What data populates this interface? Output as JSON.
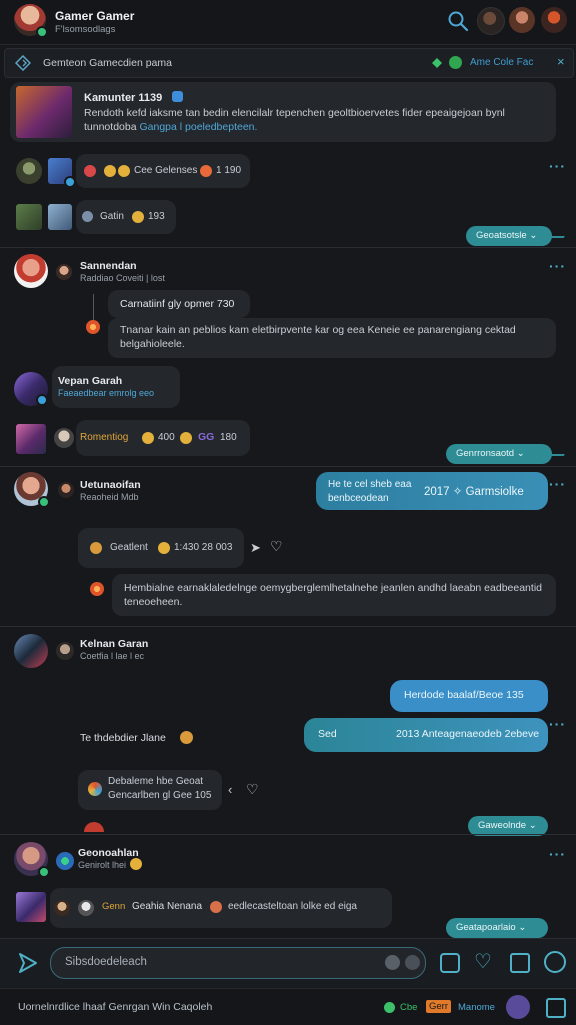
{
  "header": {
    "title": "Gamer Gamer",
    "subtitle": "F'lsomsodlags"
  },
  "banner": {
    "text": "Gemteon Gamecdien pama",
    "right_text": "Ame Cole Fac"
  },
  "messages": [
    {
      "title": "Kamunter 1139",
      "text": "Rendoth kefd iaksme tan bedin elencilalr tepenchen geoltbioervetes fider epeaigejoan bynl tunnotdoba",
      "link": "Gangpa l poeledbepteen."
    },
    {
      "reaction_label": "Cee Gelenses",
      "reaction_count": "1 190"
    },
    {
      "reaction_label": "Gatin",
      "reaction_count": "193"
    }
  ],
  "pills": [
    "Geoatsotsle",
    "Genrronsaotd",
    "Gaweolnde",
    "Geatapoarlaio"
  ],
  "users": [
    {
      "name": "Sannendan",
      "sub": "Raddiao Coveiti | lost"
    },
    {
      "name": "Vepan Garah",
      "sub": "Faeaedbear emrolg eeo"
    },
    {
      "name": "Uetunaoifan",
      "sub": "Reaoheid Mdb"
    },
    {
      "name": "Kelnan Garan",
      "sub": "Coetfia l lae l ec"
    },
    {
      "name": "Geonoahlan",
      "sub": "Genirolt lhei"
    }
  ],
  "thread1": {
    "card_title": "Carnatiinf gly opmer 730",
    "text": "Tnanar kain an peblios kam eletbirpvente kar og eea Keneie ee panarengiang cektad belgahioleele."
  },
  "thread2": {
    "gold_label": "Romentiog",
    "count1": "400",
    "badge": "GG",
    "count2": "180"
  },
  "thread3": {
    "bubble_line1": "He te cel sheb eaa",
    "bubble_line2": "benbceodean",
    "bubble_right": "2017 ✧ Garmsiolke",
    "react_label": "Geatlent",
    "react_count": "1:430 28 003",
    "text": "Hembialne earnaklaledelnge oemygberglemlhetalnehe jeanlen andhd laeabn eadbeeantid teneoeheen."
  },
  "thread4": {
    "bubble1": "Herdode baalaf/Beoe 135",
    "bubble2_left": "Sed",
    "bubble2_right": "2013 Anteagenaeodeb 2ebeve",
    "label": "Te thdebdier Jlane",
    "card_line1": "Debaleme hbe Geoat",
    "card_line2": "Gencarlben gl Gee 105"
  },
  "thread5": {
    "gold": "Genn",
    "label": "Geahia Nenana",
    "text": "eedlecasteltoan lolke ed eiga"
  },
  "composer": {
    "placeholder": "Sibsdoedeleach"
  },
  "status_bar": {
    "left": "Uornelnrdlice lhaaf Genrgan Win Caqoleh",
    "ch1": "Cbe",
    "ch2": "Gerr",
    "ch3": "Manome"
  },
  "colors": {
    "accent": "#2e8c94",
    "bubble_blue": "#3a8fc0",
    "background": "#16181c"
  }
}
